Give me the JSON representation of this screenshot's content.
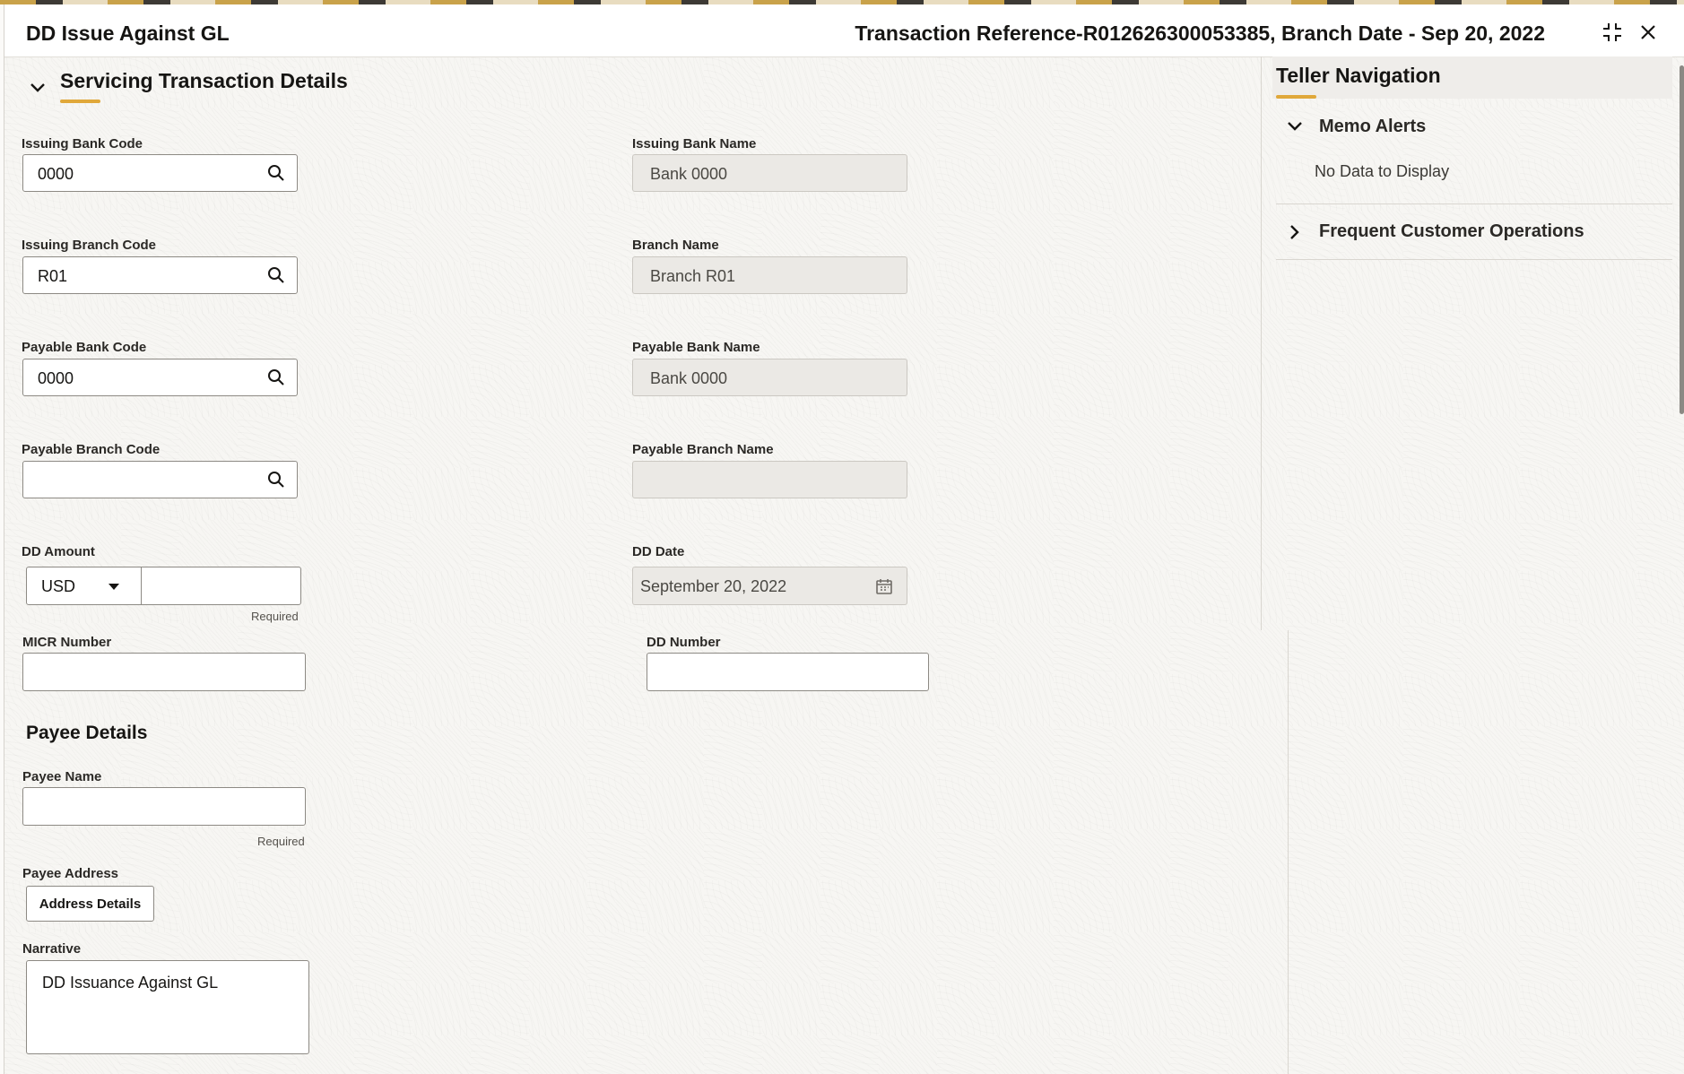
{
  "header": {
    "title": "DD Issue Against GL",
    "reference": "Transaction Reference-R012626300053385, Branch Date - Sep 20, 2022"
  },
  "section": {
    "title": "Servicing Transaction Details"
  },
  "fields": {
    "issuing_bank_code": {
      "label": "Issuing Bank Code",
      "value": "0000"
    },
    "issuing_bank_name": {
      "label": "Issuing Bank Name",
      "value": "Bank 0000"
    },
    "issuing_branch_code": {
      "label": "Issuing Branch Code",
      "value": "R01"
    },
    "branch_name": {
      "label": "Branch Name",
      "value": "Branch R01"
    },
    "payable_bank_code": {
      "label": "Payable Bank Code",
      "value": "0000"
    },
    "payable_bank_name": {
      "label": "Payable Bank Name",
      "value": "Bank 0000"
    },
    "payable_branch_code": {
      "label": "Payable Branch Code",
      "value": ""
    },
    "payable_branch_name": {
      "label": "Payable Branch Name",
      "value": ""
    },
    "dd_amount": {
      "label": "DD Amount",
      "currency": "USD",
      "value": "",
      "hint": "Required"
    },
    "dd_date": {
      "label": "DD Date",
      "value": "September 20, 2022"
    },
    "micr_number": {
      "label": "MICR Number",
      "value": ""
    },
    "dd_number": {
      "label": "DD Number",
      "value": ""
    }
  },
  "payee": {
    "title": "Payee Details",
    "name_label": "Payee Name",
    "name_value": "",
    "name_hint": "Required",
    "address_label": "Payee Address",
    "address_button": "Address Details",
    "narrative_label": "Narrative",
    "narrative_value": "DD Issuance Against GL"
  },
  "teller": {
    "title": "Teller Navigation",
    "memo_alerts": "Memo Alerts",
    "memo_empty": "No Data to Display",
    "frequent_ops": "Frequent Customer Operations"
  },
  "colors": {
    "accent": "#e0a83a",
    "readonly_bg": "#ebe9e5",
    "border": "#8d8a84"
  },
  "icons": [
    "search-icon",
    "chevron-down-icon",
    "chevron-right-icon",
    "calendar-icon",
    "minimize-icon",
    "close-icon",
    "caret-down-icon"
  ]
}
